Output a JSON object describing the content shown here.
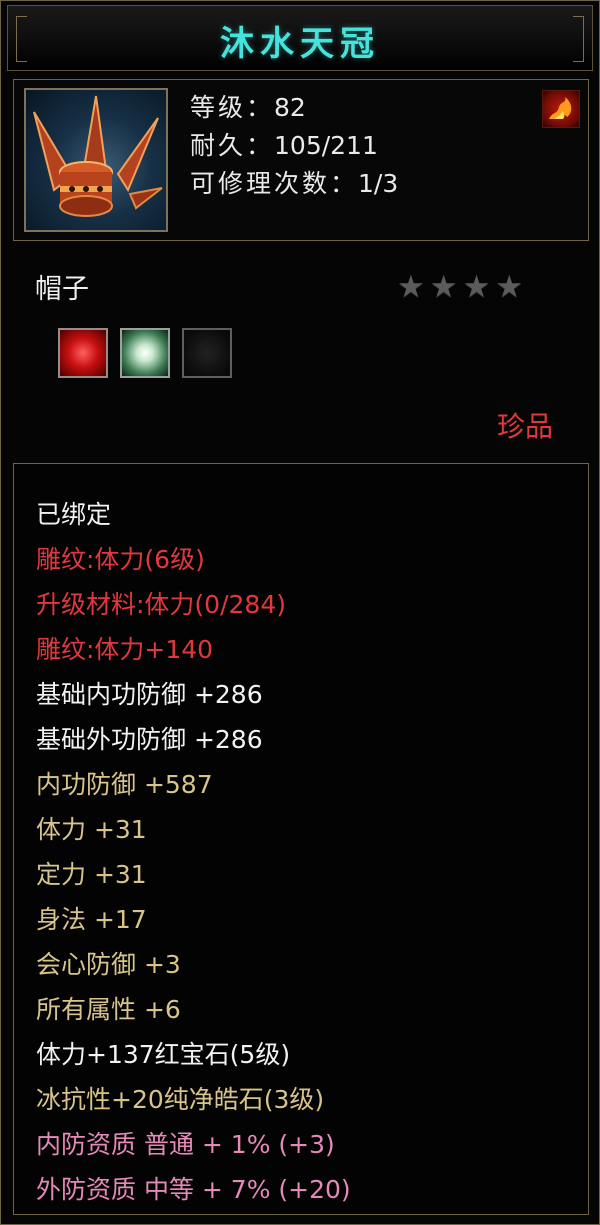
{
  "item": {
    "name": "沐水天冠",
    "level_label": "等级：",
    "level_value": "82",
    "durability_label": "耐久：",
    "durability_value": "105/211",
    "repair_label": "可修理次数：",
    "repair_value": "1/3",
    "type": "帽子",
    "rarity": "珍品",
    "stars_total": 4,
    "stars_filled": 0,
    "icon": "hat-icon",
    "element_icon": "fire-icon"
  },
  "gems": [
    {
      "icon": "ruby-gem-icon",
      "color": "#c70f10"
    },
    {
      "icon": "white-gem-icon",
      "color": "#c9e9cf"
    },
    {
      "icon": "empty-socket-icon",
      "color": "#0a0a0a"
    }
  ],
  "attributes": [
    {
      "text": "已绑定",
      "color": "white"
    },
    {
      "text": "雕纹:体力(6级)",
      "color": "red"
    },
    {
      "text": "升级材料:体力(0/284)",
      "color": "red"
    },
    {
      "text": "雕纹:体力+140",
      "color": "red"
    },
    {
      "text": "基础内功防御 +286",
      "color": "white"
    },
    {
      "text": "基础外功防御 +286",
      "color": "white"
    },
    {
      "text": "内功防御 +587",
      "color": "gold"
    },
    {
      "text": "体力 +31",
      "color": "gold"
    },
    {
      "text": "定力 +31",
      "color": "gold"
    },
    {
      "text": "身法 +17",
      "color": "gold"
    },
    {
      "text": "会心防御 +3",
      "color": "gold"
    },
    {
      "text": "所有属性 +6",
      "color": "gold"
    },
    {
      "text": "体力+137红宝石(5级)",
      "color": "white"
    },
    {
      "text": "冰抗性+20纯净皓石(3级)",
      "color": "gold"
    },
    {
      "text": "内防资质 普通 + 1% (+3)",
      "color": "pink"
    },
    {
      "text": "外防资质 中等 + 7% (+20)",
      "color": "pink"
    }
  ],
  "colors": {
    "title": "#46e3dc",
    "white": "#f2f2f2",
    "red": "#e0383e",
    "gold": "#d8c48a",
    "pink": "#e489b8",
    "border": "#6d6346"
  }
}
